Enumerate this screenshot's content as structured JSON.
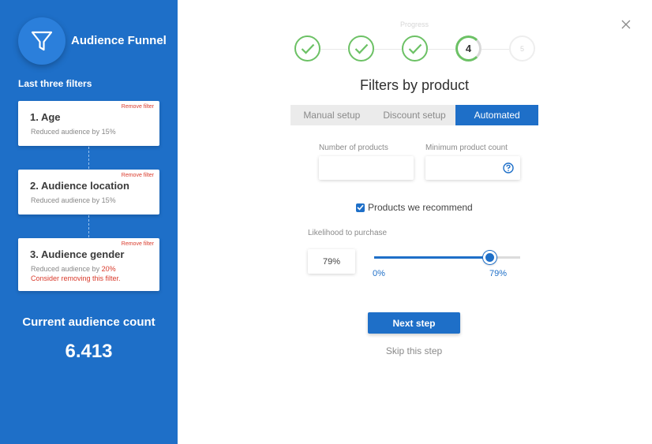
{
  "sidebar": {
    "app_title": "Audience Funnel",
    "logo_icon": "funnel-icon",
    "section_label": "Last three filters",
    "filters": [
      {
        "remove_label": "Remove filter",
        "title": "1. Age",
        "desc": "Reduced audience by 15%"
      },
      {
        "remove_label": "Remove filter",
        "title": "2. Audience location",
        "desc": "Reduced audience by 15%"
      },
      {
        "remove_label": "Remove filter",
        "title": "3. Audience gender",
        "desc_prefix": "Reduced audience by ",
        "desc_highlight": "20%",
        "warning": "Consider removing this filter."
      }
    ],
    "count_label": "Current audience count",
    "count_value": "6.413"
  },
  "progress": {
    "label": "Progress",
    "steps": [
      {
        "state": "done",
        "icon": "check-icon"
      },
      {
        "state": "done",
        "icon": "check-icon"
      },
      {
        "state": "done",
        "icon": "check-icon"
      },
      {
        "state": "current",
        "label": "4"
      },
      {
        "state": "future",
        "label": "5"
      }
    ]
  },
  "main": {
    "title": "Filters by product",
    "tabs": [
      {
        "label": "Manual setup",
        "active": false
      },
      {
        "label": "Discount setup",
        "active": false
      },
      {
        "label": "Automated",
        "active": true
      }
    ],
    "fields": {
      "num_products_label": "Number of products",
      "num_products_value": "",
      "min_count_label": "Minimum product count",
      "min_count_value": ""
    },
    "checkbox": {
      "label": "Products we recommend",
      "checked": true
    },
    "likelihood": {
      "label": "Likelihood to purchase",
      "value_text": "79%",
      "value": 0.79,
      "min_label": "0%",
      "max_label": "79%"
    },
    "next_button": "Next step",
    "skip_link": "Skip this step"
  },
  "colors": {
    "brand": "#1e6fc8",
    "success": "#6cc165",
    "danger": "#d93a2b"
  }
}
